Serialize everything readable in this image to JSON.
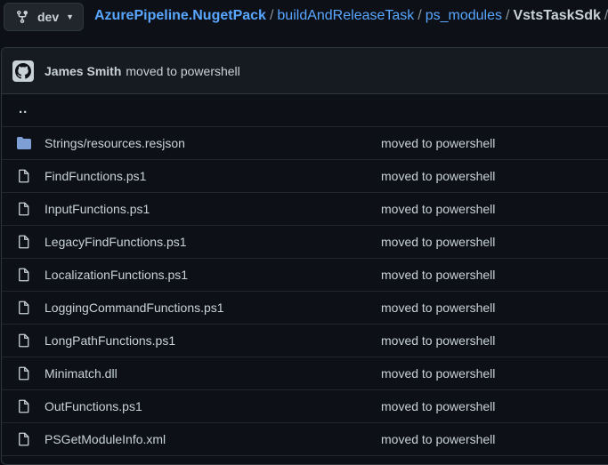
{
  "branch": {
    "name": "dev",
    "icon": "git-branch-icon"
  },
  "breadcrumb": {
    "repo": "AzurePipeline.NugetPack",
    "separator": "/",
    "parts": [
      "buildAndReleaseTask",
      "ps_modules"
    ],
    "current": "VstsTaskSdk",
    "trailing": "/"
  },
  "commit": {
    "author": "James Smith",
    "message": "moved to powershell",
    "avatar_icon": "github-avatar-icon"
  },
  "parent_link": "..",
  "files": [
    {
      "name": "Strings/resources.resjson",
      "type": "folder",
      "commit": "moved to powershell"
    },
    {
      "name": "FindFunctions.ps1",
      "type": "file",
      "commit": "moved to powershell"
    },
    {
      "name": "InputFunctions.ps1",
      "type": "file",
      "commit": "moved to powershell"
    },
    {
      "name": "LegacyFindFunctions.ps1",
      "type": "file",
      "commit": "moved to powershell"
    },
    {
      "name": "LocalizationFunctions.ps1",
      "type": "file",
      "commit": "moved to powershell"
    },
    {
      "name": "LoggingCommandFunctions.ps1",
      "type": "file",
      "commit": "moved to powershell"
    },
    {
      "name": "LongPathFunctions.ps1",
      "type": "file",
      "commit": "moved to powershell"
    },
    {
      "name": "Minimatch.dll",
      "type": "file",
      "commit": "moved to powershell"
    },
    {
      "name": "OutFunctions.ps1",
      "type": "file",
      "commit": "moved to powershell"
    },
    {
      "name": "PSGetModuleInfo.xml",
      "type": "file",
      "commit": "moved to powershell"
    }
  ],
  "colors": {
    "link": "#58a6ff",
    "folder": "#7d9fd6",
    "background": "#0d1117"
  }
}
